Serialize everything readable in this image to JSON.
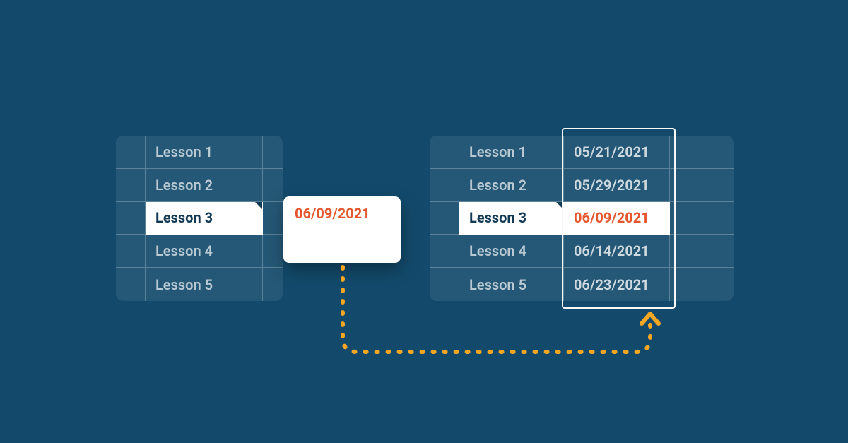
{
  "colors": {
    "bg": "#134a6b",
    "accent": "#e4572e",
    "arrow": "#f5a623"
  },
  "selected_index": 2,
  "left_table": {
    "rows": [
      {
        "label": "Lesson 1"
      },
      {
        "label": "Lesson 2"
      },
      {
        "label": "Lesson 3"
      },
      {
        "label": "Lesson 4"
      },
      {
        "label": "Lesson 5"
      }
    ]
  },
  "popover": {
    "date": "06/09/2021"
  },
  "right_table": {
    "rows": [
      {
        "label": "Lesson 1",
        "date": "05/21/2021"
      },
      {
        "label": "Lesson 2",
        "date": "05/29/2021"
      },
      {
        "label": "Lesson 3",
        "date": "06/09/2021"
      },
      {
        "label": "Lesson 4",
        "date": "06/14/2021"
      },
      {
        "label": "Lesson 5",
        "date": "06/23/2021"
      }
    ]
  }
}
